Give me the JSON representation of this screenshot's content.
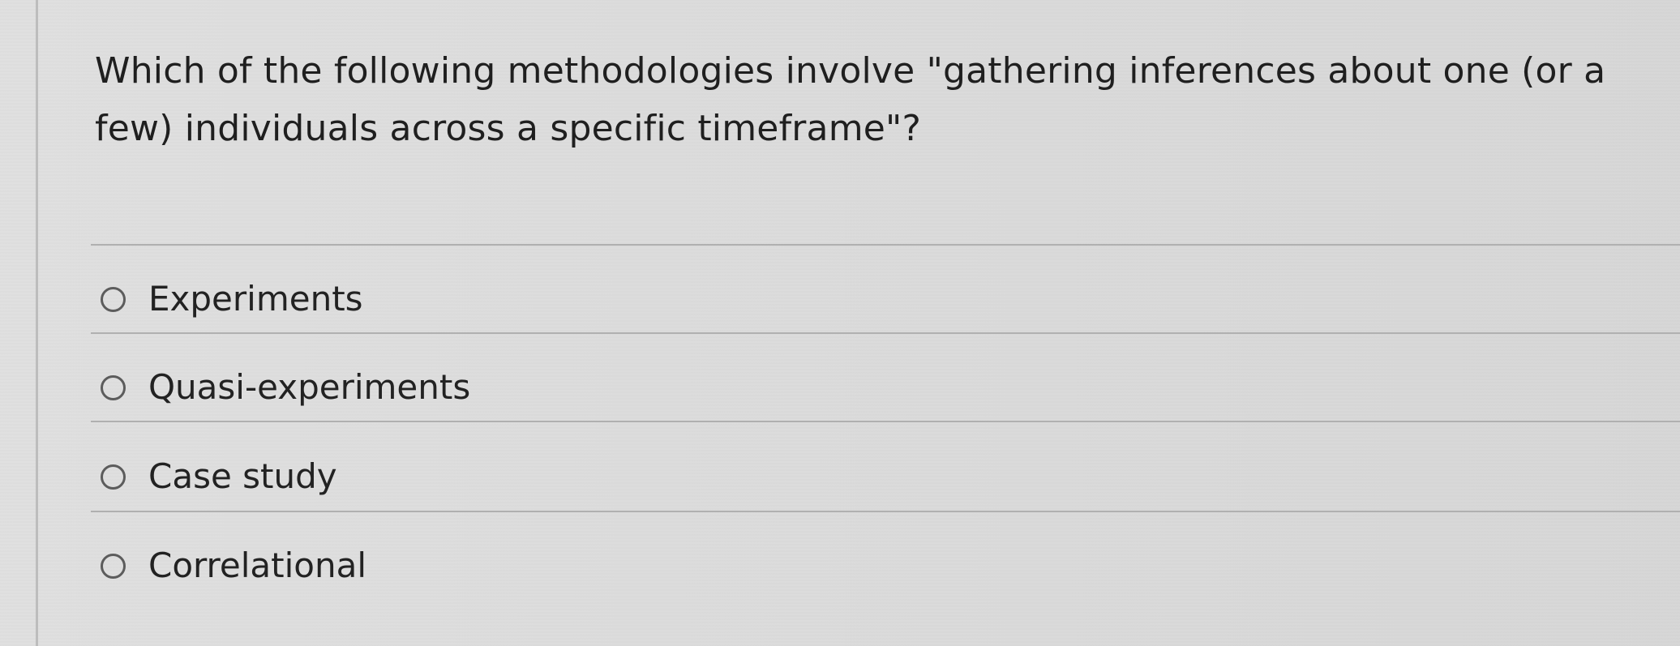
{
  "question": {
    "text": "Which of the following methodologies involve \"gathering inferences about one (or a few) individuals across a specific timeframe\"?"
  },
  "options": [
    {
      "label": "Experiments",
      "selected": false
    },
    {
      "label": "Quasi-experiments",
      "selected": false
    },
    {
      "label": "Case study",
      "selected": false
    },
    {
      "label": "Correlational",
      "selected": false
    }
  ],
  "colors": {
    "background": "#dedede",
    "text": "#1f1f1f",
    "radio_border": "#5c5c5c",
    "divider": "#b0b0b0"
  },
  "icons": {
    "radio": "radio-button-icon"
  }
}
